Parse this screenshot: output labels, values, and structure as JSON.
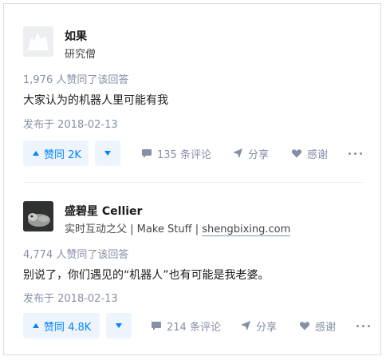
{
  "answers": [
    {
      "author_name": "如果",
      "author_bio": "研究僧",
      "votes_line": "1,976 人赞同了该回答",
      "content": "大家认为的机器人里可能有我",
      "date": "发布于 2018-02-13",
      "vote_label": "赞同 2K",
      "comments_label": "135 条评论",
      "share_label": "分享",
      "thanks_label": "感谢"
    },
    {
      "author_name": "盛碧星 Cellier",
      "author_bio_prefix": "实时互动之父 | Make Stuff | ",
      "author_bio_link": "shengbixing.com",
      "votes_line": "4,774 人赞同了该回答",
      "content": "别说了，你们遇见的“机器人”也有可能是我老婆。",
      "date": "发布于 2018-02-13",
      "vote_label": "赞同 4.8K",
      "comments_label": "214 条评论",
      "share_label": "分享",
      "thanks_label": "感谢"
    }
  ],
  "colors": {
    "accent": "#0084ff",
    "meta_gray": "#8590a6",
    "vote_bg": "#eef4fc"
  }
}
